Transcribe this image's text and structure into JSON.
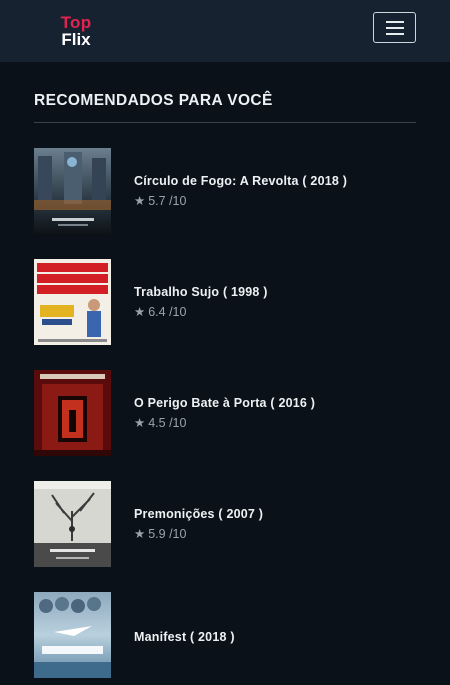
{
  "brand": {
    "line1": "Top",
    "line2": "Flix"
  },
  "section": {
    "title": "RECOMENDADOS PARA VOCÊ"
  },
  "movies": [
    {
      "title": "Círculo de Fogo: A Revolta",
      "year": "( 2018 )",
      "rating": "5.7 /10"
    },
    {
      "title": "Trabalho Sujo",
      "year": "( 1998 )",
      "rating": "6.4 /10"
    },
    {
      "title": "O Perigo Bate à Porta",
      "year": "( 2016 )",
      "rating": "4.5 /10"
    },
    {
      "title": "Premonições",
      "year": "( 2007 )",
      "rating": "5.9 /10"
    },
    {
      "title": "Manifest",
      "year": "( 2018 )",
      "rating": ""
    }
  ],
  "icons": {
    "menu": "hamburger-menu-icon",
    "star": "star-icon"
  },
  "colors": {
    "background": "#0b1118",
    "navbar": "#172230",
    "brand_accent": "#e0244f"
  }
}
